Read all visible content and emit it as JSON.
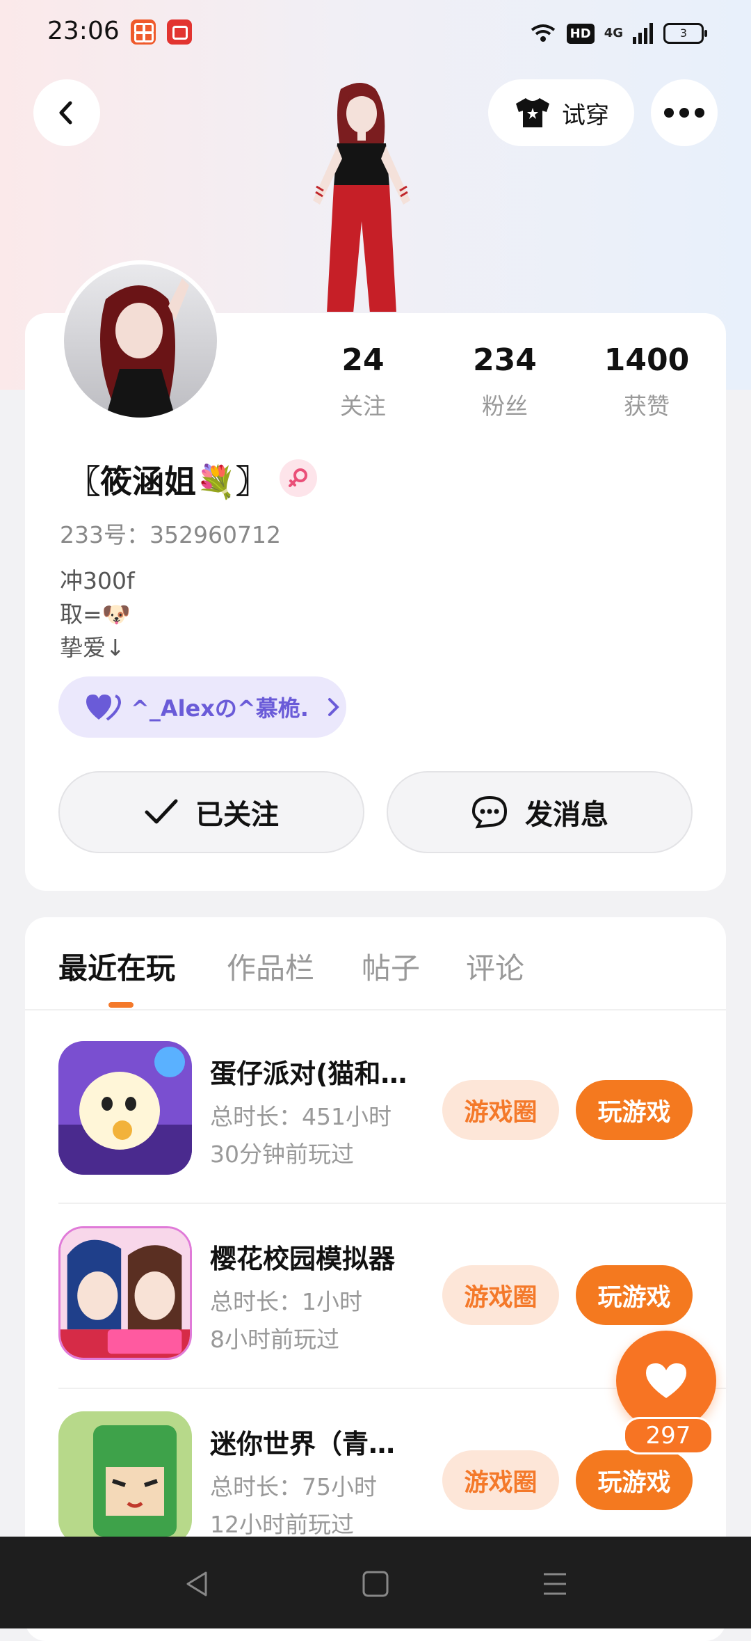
{
  "status_bar": {
    "time": "23:06",
    "hd": "HD",
    "network": "4G",
    "battery": "3"
  },
  "header": {
    "try_on_label": "试穿"
  },
  "profile": {
    "stats": [
      {
        "value": "24",
        "label": "关注"
      },
      {
        "value": "234",
        "label": "粉丝"
      },
      {
        "value": "1400",
        "label": "获赞"
      }
    ],
    "name": "〖筱涵姐💐〗",
    "uid": "233号：352960712",
    "bio": [
      "冲300f",
      "取=🐶",
      "挚爱↓"
    ],
    "couple_name": "^_Alexの^慕桅.",
    "follow_label": "已关注",
    "message_label": "发消息"
  },
  "tabs": [
    {
      "label": "最近在玩",
      "active": true
    },
    {
      "label": "作品栏",
      "active": false
    },
    {
      "label": "帖子",
      "active": false
    },
    {
      "label": "评论",
      "active": false
    }
  ],
  "games": [
    {
      "title": "蛋仔派对(猫和老鼠)",
      "total_time": "总时长：451小时",
      "last_played": "30分钟前玩过",
      "circle_label": "游戏圈",
      "play_label": "玩游戏"
    },
    {
      "title": "樱花校园模拟器",
      "total_time": "总时长：1小时",
      "last_played": "8小时前玩过",
      "circle_label": "游戏圈",
      "play_label": "玩游戏"
    },
    {
      "title": "迷你世界（青少年版）",
      "total_time": "总时长：75小时",
      "last_played": "12小时前玩过",
      "circle_label": "游戏圈",
      "play_label": "玩游戏"
    }
  ],
  "like_fab": {
    "count": "297"
  },
  "colors": {
    "accent": "#f4791f",
    "couple": "#6a5bd8"
  },
  "icons": [
    "back-icon",
    "tshirt-icon",
    "more-icon",
    "female-icon",
    "heart-icon",
    "check-icon",
    "chat-icon",
    "chevron-right-icon"
  ]
}
